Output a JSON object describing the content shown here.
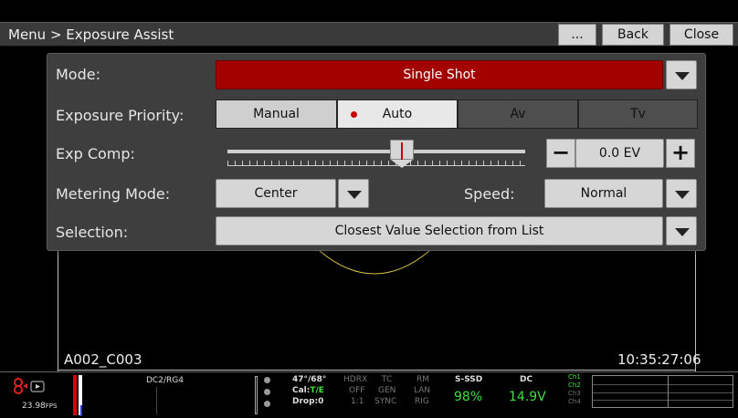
{
  "titlebar": {
    "breadcrumb": "Menu > Exposure Assist",
    "more_label": "...",
    "back_label": "Back",
    "close_label": "Close"
  },
  "menu": {
    "mode": {
      "label": "Mode:",
      "value": "Single Shot"
    },
    "exposure_priority": {
      "label": "Exposure Priority:",
      "options": [
        "Manual",
        "Auto",
        "Av",
        "Tv"
      ],
      "selected": "Auto"
    },
    "exp_comp": {
      "label": "Exp Comp:",
      "value": "0.0 EV",
      "minus": "−",
      "plus": "+"
    },
    "metering_mode": {
      "label": "Metering Mode:",
      "value": "Center"
    },
    "speed": {
      "label": "Speed:",
      "value": "Normal"
    },
    "selection": {
      "label": "Selection:",
      "value": "Closest Value Selection from List"
    }
  },
  "overlay": {
    "clip_name": "A002_C003",
    "timecode": "10:35:27:06"
  },
  "status": {
    "fps": "23.98",
    "fps_unit": "FPS",
    "look": "DC2/RG4",
    "temp": "47°/68°",
    "cal": "Cal:",
    "cal_value": "T/E",
    "drop": "Drop:0",
    "hdrx": "HDRX",
    "hdrx_val": "OFF",
    "hdrx_sub": "1:1",
    "tc": "TC",
    "tc_val": "GEN",
    "tc_sub": "SYNC",
    "rm": "RM",
    "rm_val": "LAN",
    "rm_sub": "RIG",
    "media_label": "S-SSD",
    "media_value": "98%",
    "power_label": "DC",
    "power_value": "14.9V",
    "channels": [
      "Ch1",
      "Ch2",
      "Ch3",
      "Ch4"
    ]
  },
  "colors": {
    "accent_red": "#a30000",
    "status_green": "#3fe03f"
  }
}
